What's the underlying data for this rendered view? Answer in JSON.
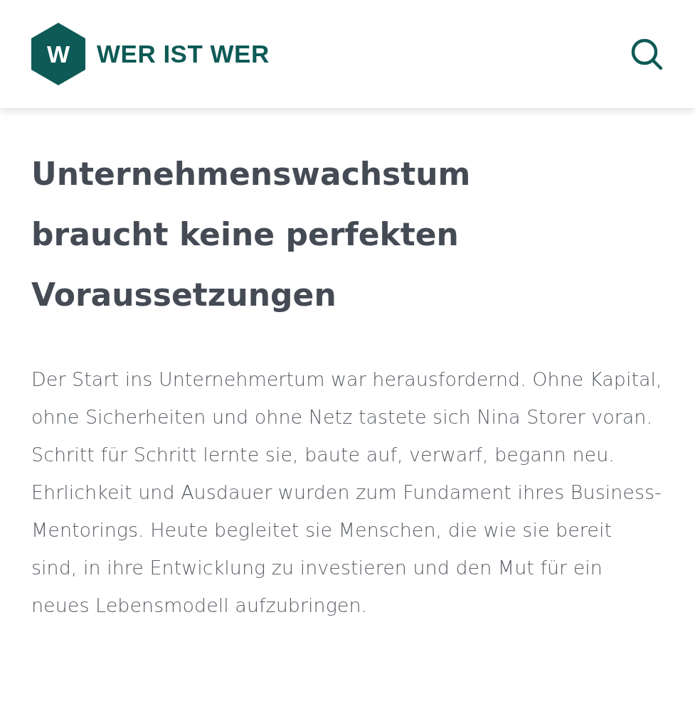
{
  "header": {
    "logo_letter": "W",
    "logo_text": "WER IST WER"
  },
  "article": {
    "title": "Unternehmenswachstum braucht keine perfekten Voraussetzungen",
    "body": "Der Start ins Unternehmertum war herausfordernd. Ohne Kapital, ohne Sicherheiten und ohne Netz tastete sich Nina Storer voran. Schritt für Schritt lernte sie, baute auf, verwarf, begann neu. Ehrlichkeit und Ausdauer wurden zum Fundament ihres Business-Mentorings. Heute begleitet sie Menschen, die wie sie bereit sind, in ihre Entwicklung zu investieren und den Mut für ein neues Lebensmodell aufzubringen."
  }
}
